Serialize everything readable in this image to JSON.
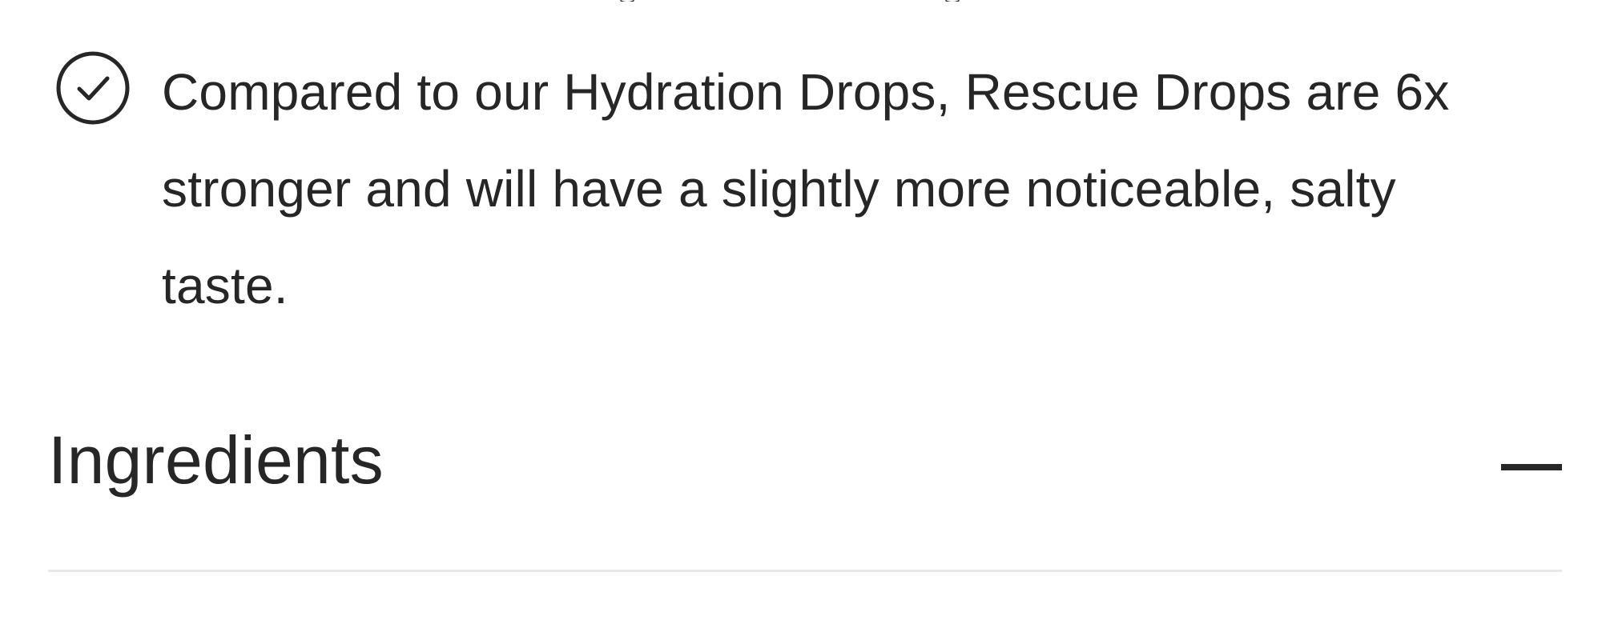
{
  "benefit": {
    "icon": "check-circle-icon",
    "text": "Compared to our Hydration Drops, Rescue Drops are 6x stronger and will have a slightly more noticeable, salty taste."
  },
  "accordion": {
    "title": "Ingredients",
    "state_icon": "minus-icon",
    "expanded": true
  },
  "colors": {
    "text": "#262626",
    "divider": "#e8e8e8",
    "background": "#ffffff"
  }
}
